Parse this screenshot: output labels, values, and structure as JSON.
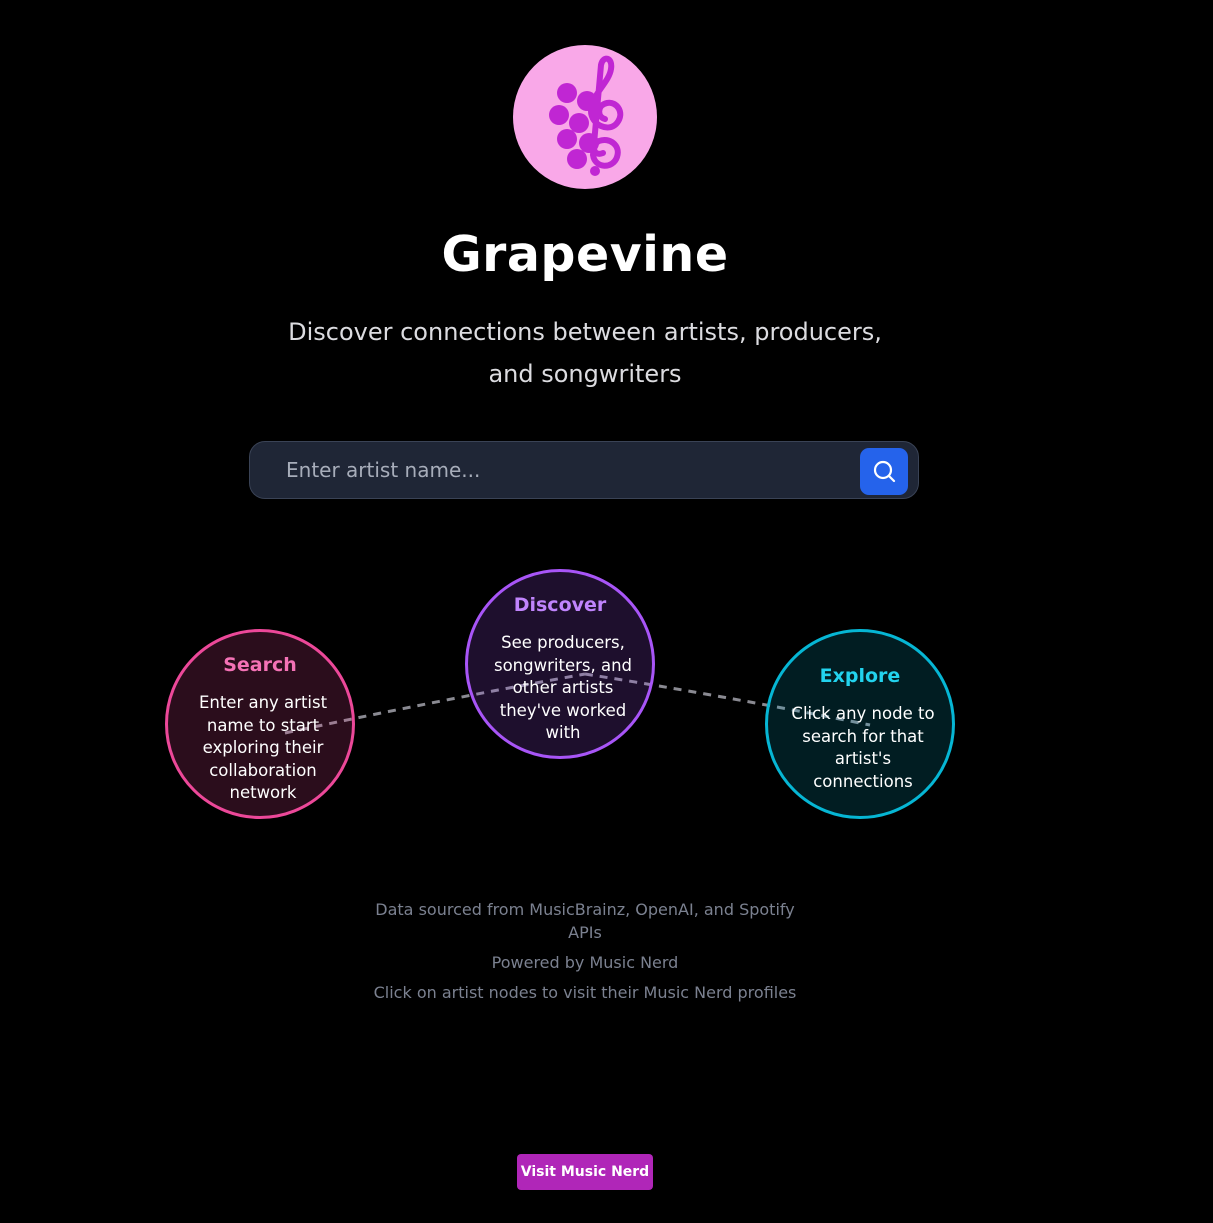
{
  "brand": {
    "logo_icon": "grape-treble-clef-icon",
    "title": "Grapevine",
    "subtitle": "Discover connections between artists, producers, and songwriters"
  },
  "search": {
    "placeholder": "Enter artist name...",
    "value": "",
    "button_icon": "search-icon"
  },
  "steps": [
    {
      "title": "Search",
      "text": "Enter any artist name to start exploring their collaboration network",
      "color": "#ec4899"
    },
    {
      "title": "Discover",
      "text": "See producers, songwriters, and other artists they've worked with",
      "color": "#a855f7"
    },
    {
      "title": "Explore",
      "text": "Click any node to search for that artist's connections",
      "color": "#06b6d4"
    }
  ],
  "footer": {
    "sources": "Data sourced from MusicBrainz, OpenAI, and Spotify APIs",
    "powered": "Powered by Music Nerd",
    "hint": "Click on artist nodes to visit their Music Nerd profiles"
  },
  "cta": {
    "visit_label": "Visit Music Nerd"
  },
  "colors": {
    "background": "#000000",
    "accent_blue": "#2563eb",
    "cta_purple": "#b026b8",
    "logo_bg": "#f9a8e8",
    "logo_fg": "#c026d3"
  }
}
